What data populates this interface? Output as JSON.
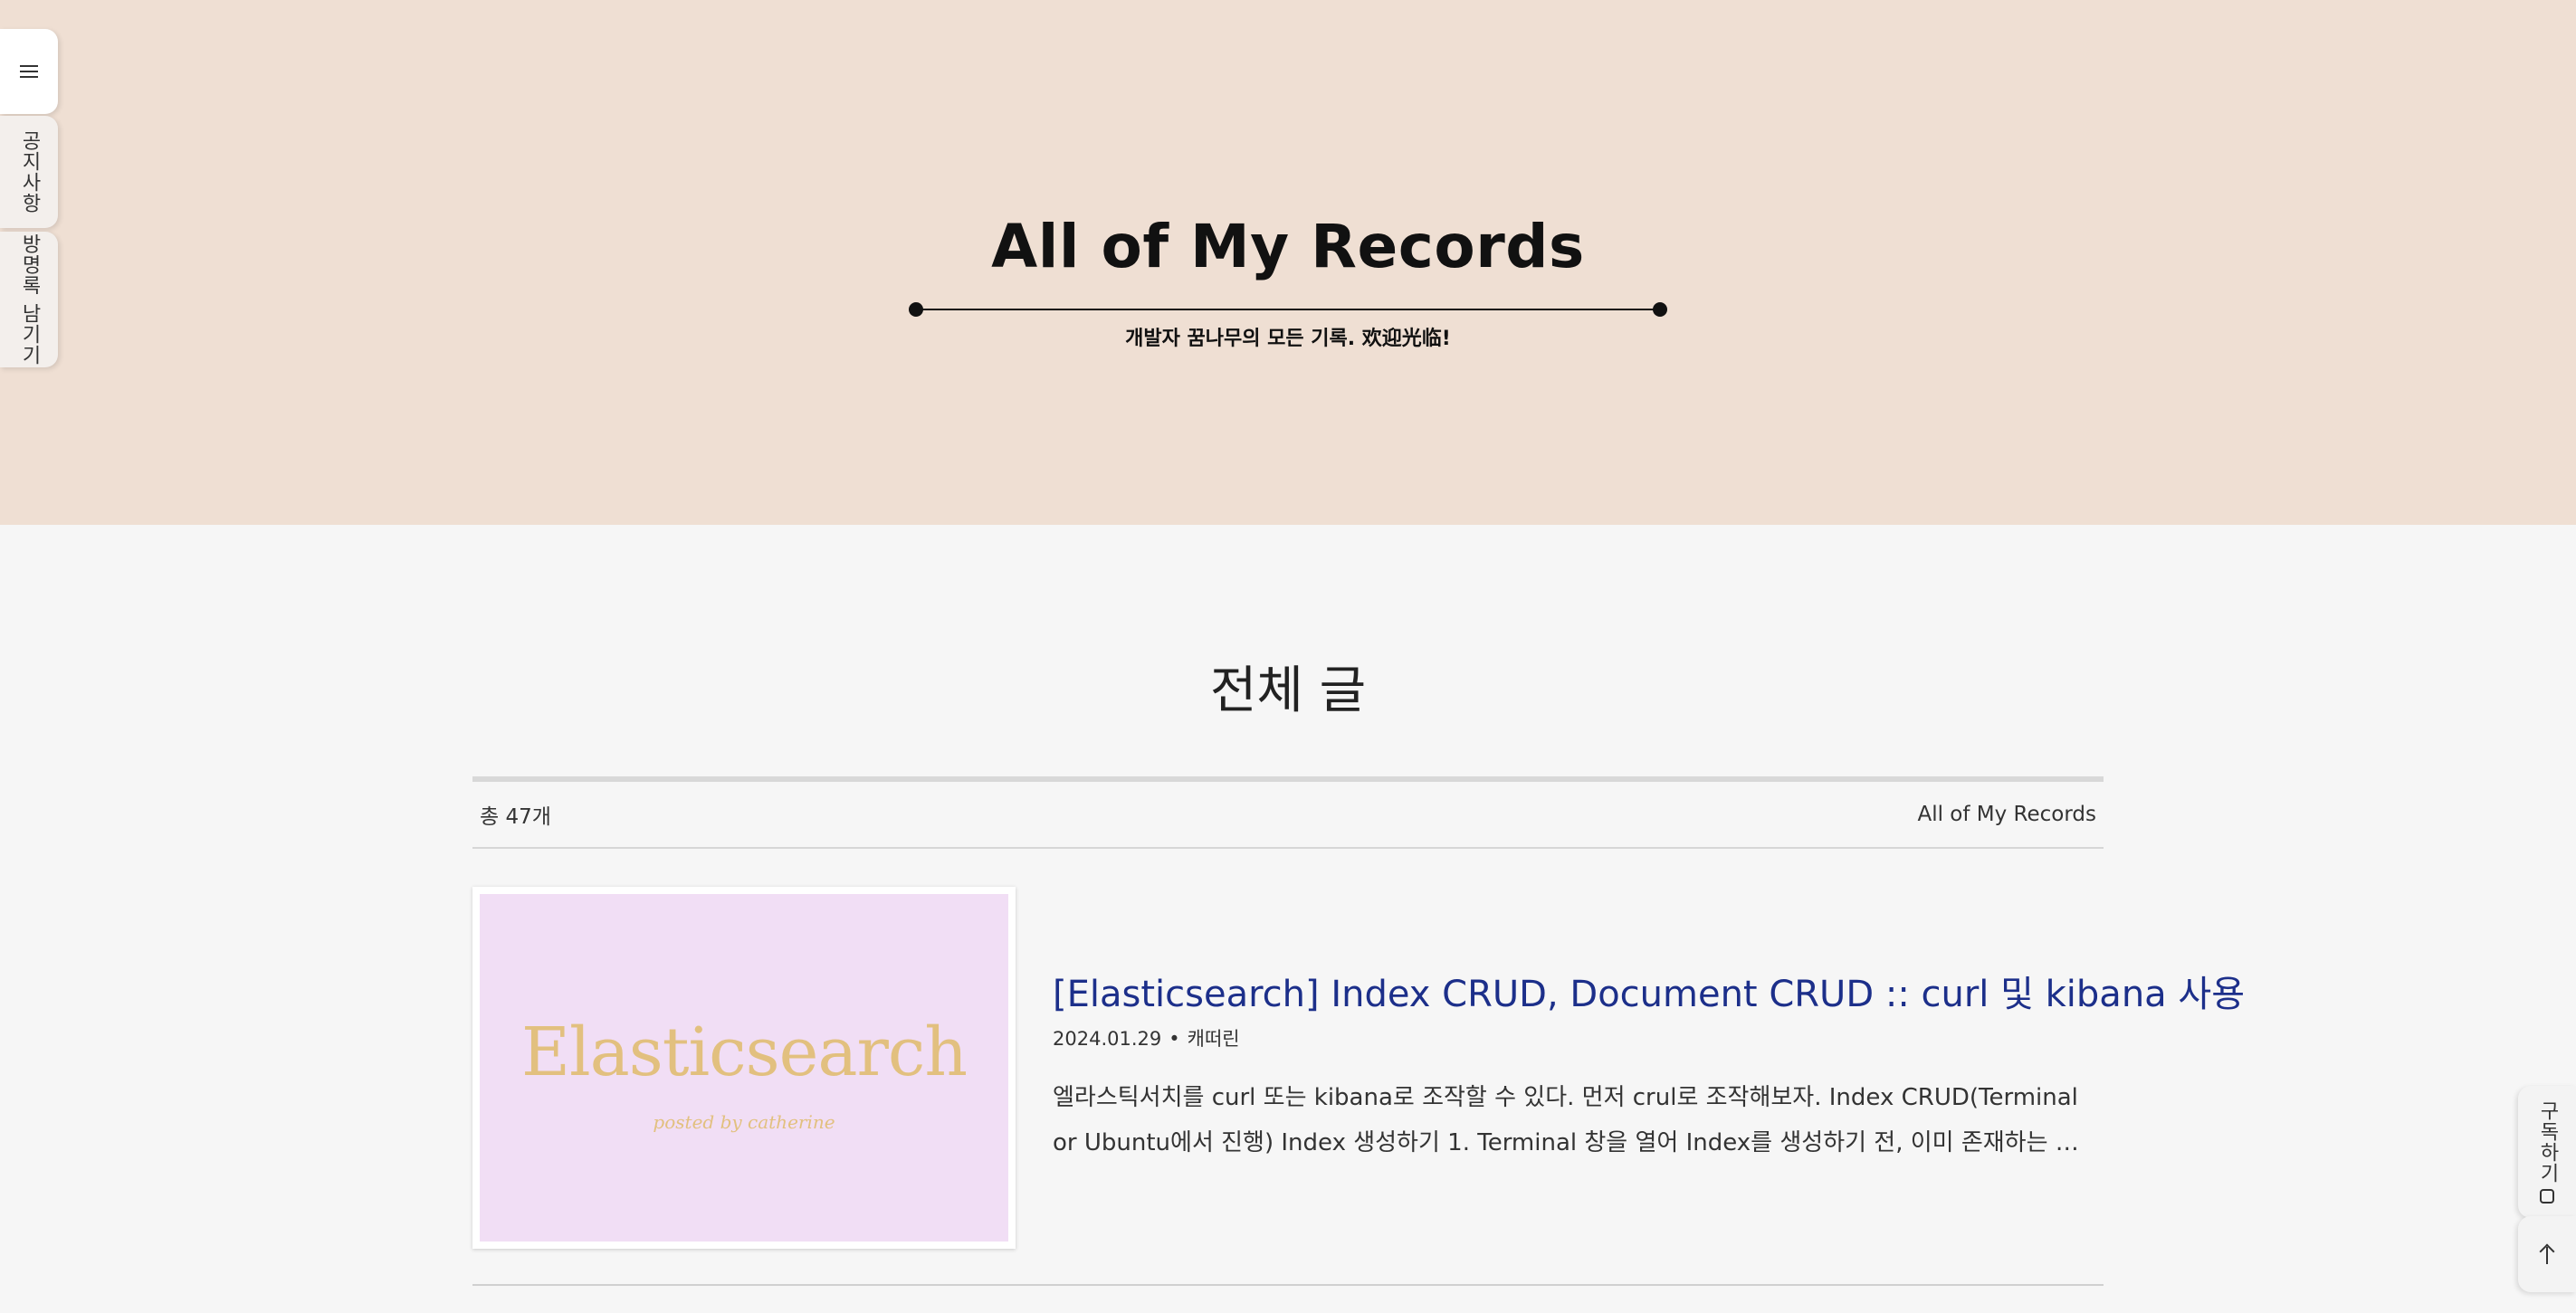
{
  "header": {
    "title": "All of My Records",
    "subtitle": "개발자 꿈나무의 모든 기록. 欢迎光临!"
  },
  "sidebar": {
    "menu_icon": "hamburger-icon",
    "tabs": [
      {
        "label": "공지사항"
      },
      {
        "label": "방명록 남기기"
      }
    ]
  },
  "main": {
    "heading": "전체 글",
    "total_count": "총 47개",
    "blog_name": "All of My Records"
  },
  "posts": [
    {
      "thumbnail_title": "Elasticsearch",
      "thumbnail_subtitle": "posted by catherine",
      "title": "[Elasticsearch] Index CRUD, Document CRUD :: curl 및 kibana 사용",
      "date": "2024.01.29",
      "category": "캐떠린",
      "excerpt": "엘라스틱서치를 curl 또는 kibana로 조작할 수 있다. 먼저 crul로 조작해보자. Index CRUD(Terminal or Ubuntu에서 진행) Index 생성하기 1. Terminal 창을 열어 Index를 생성하기 전, 이미 존재하는 인덱스인지 확인하고 생성하기"
    }
  ],
  "floating": {
    "subscribe_label": "구독하기",
    "subscribe_icon": "bell-icon",
    "top_icon": "arrow-up-icon"
  },
  "colors": {
    "header_bg": "#efdfd3",
    "page_bg": "#f6f6f6",
    "post_title": "#1c2f8a",
    "thumbnail_bg": "#f1def5",
    "thumbnail_text": "#e2c07f"
  }
}
